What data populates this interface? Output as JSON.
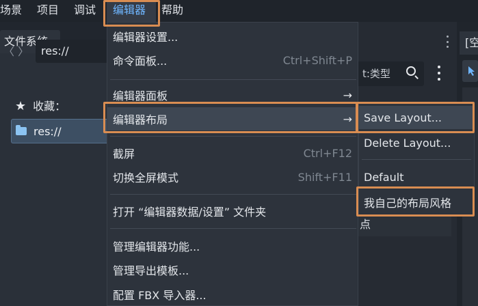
{
  "menubar": {
    "items": [
      "场景",
      "项目",
      "调试",
      "编辑器",
      "帮助"
    ],
    "active_index": 3
  },
  "filesystem": {
    "tab_title": "文件系统",
    "back_glyph": "〈",
    "forward_glyph": "〉",
    "path": "res://",
    "favorites_label": "收藏：",
    "root_item": "res://",
    "filter_placeholder": "t:类型"
  },
  "right_panel": {
    "tab_partial": "[空",
    "field_partial": "点"
  },
  "editor_menu": {
    "items": [
      {
        "label": "编辑器设置...",
        "shortcut": ""
      },
      {
        "label": "命令面板...",
        "shortcut": "Ctrl+Shift+P"
      },
      {
        "label": "编辑器面板",
        "arrow": "→"
      },
      {
        "label": "编辑器布局",
        "arrow": "→"
      },
      {
        "label": "截屏",
        "shortcut": "Ctrl+F12"
      },
      {
        "label": "切换全屏模式",
        "shortcut": "Shift+F11"
      },
      {
        "label": "打开 “编辑器数据/设置” 文件夹",
        "shortcut": ""
      },
      {
        "label": "管理编辑器功能...",
        "shortcut": ""
      },
      {
        "label": "管理导出模板...",
        "shortcut": ""
      },
      {
        "label": "配置 FBX 导入器...",
        "shortcut": ""
      }
    ]
  },
  "layout_submenu": {
    "items": [
      "Save Layout...",
      "Delete Layout...",
      "Default",
      "我自己的布局风格"
    ]
  },
  "colors": {
    "accent_blue": "#6fb6ff",
    "annotation_orange": "#d98d52",
    "menu_bg": "#2d333c",
    "highlight_bg": "#3e4753"
  }
}
